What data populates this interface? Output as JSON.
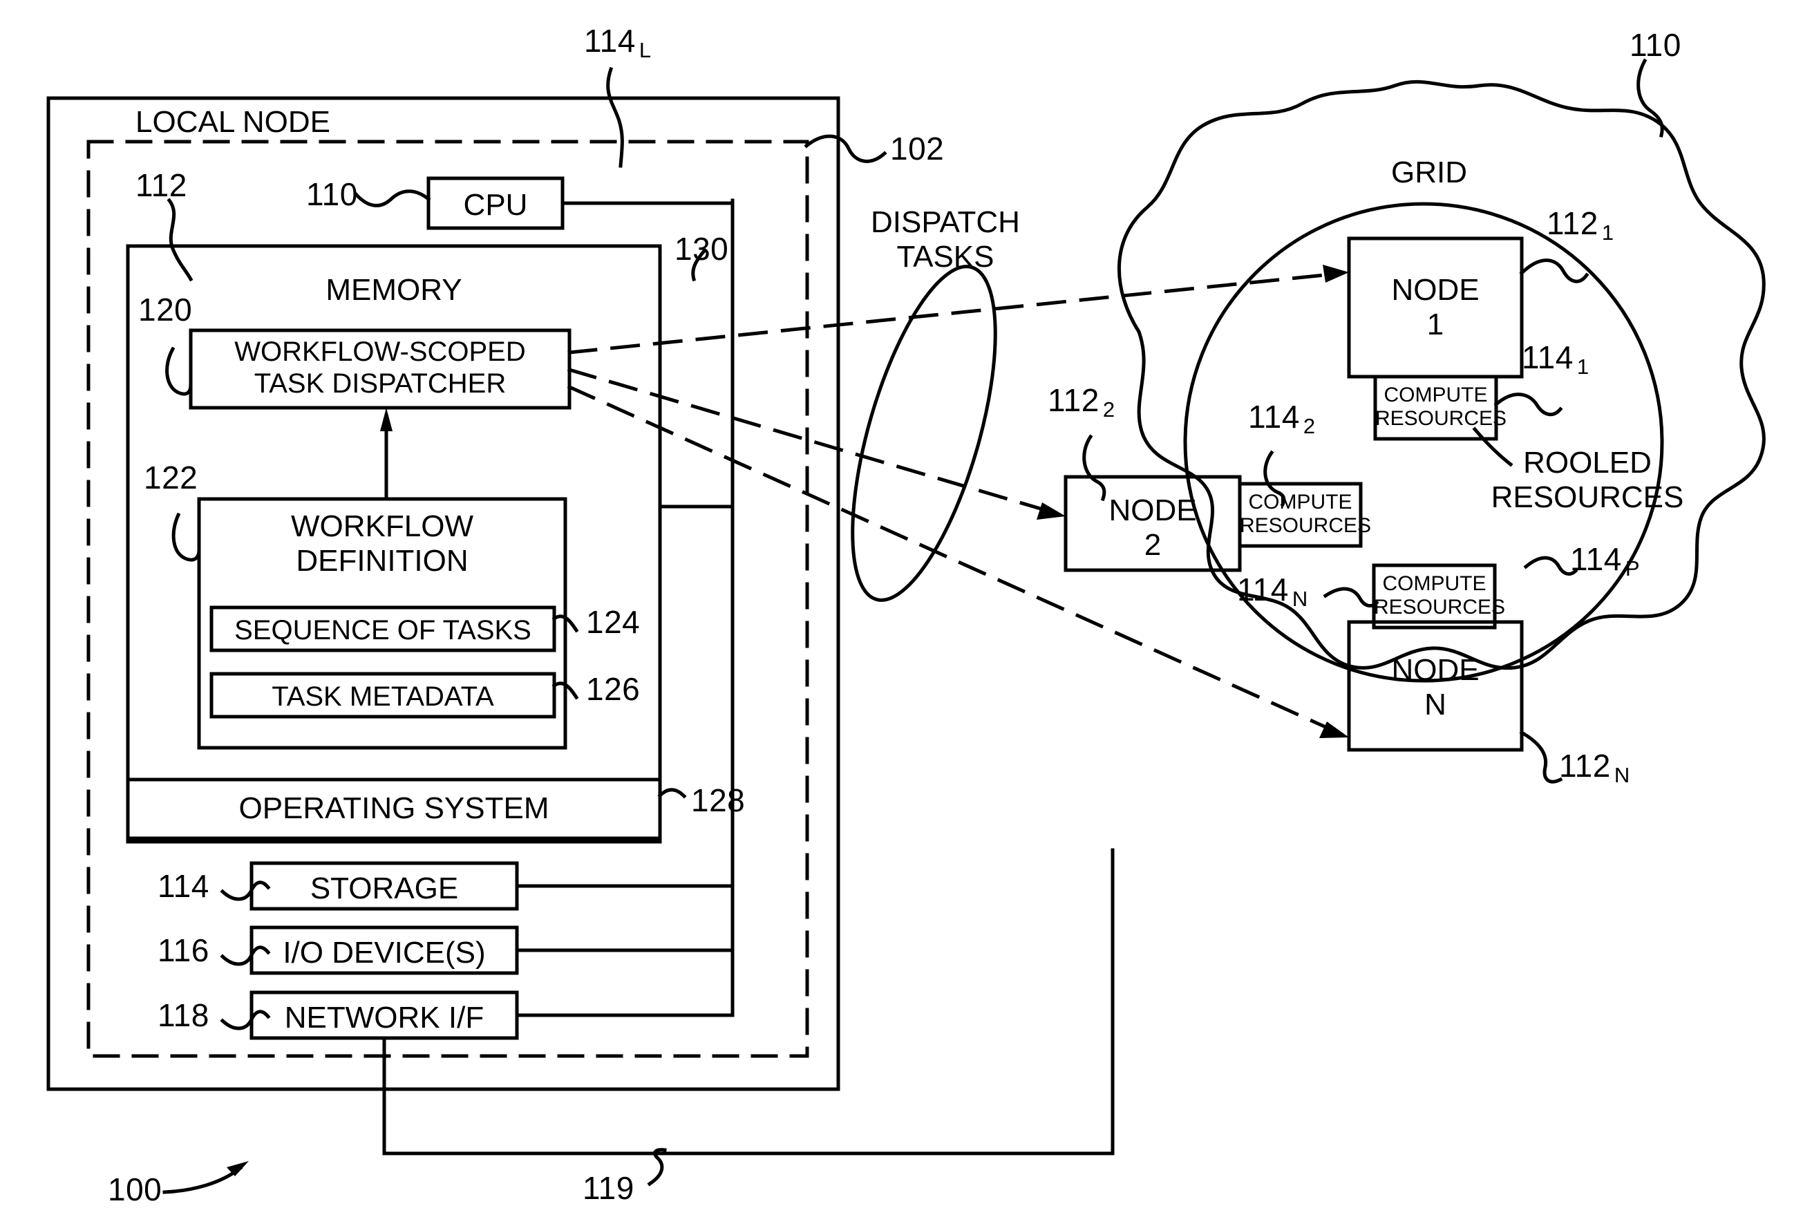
{
  "figure": {
    "number": "100",
    "local_node": {
      "title": "LOCAL NODE",
      "outer_ref": "114",
      "outer_ref_sub": "L",
      "dashed_ref": "102",
      "cpu": {
        "label": "CPU",
        "ref": "110"
      },
      "memory": {
        "label": "MEMORY",
        "ref": "112"
      },
      "bus_ref": "130",
      "dispatcher": {
        "label_line1": "WORKFLOW-SCOPED",
        "label_line2": "TASK DISPATCHER",
        "ref": "120"
      },
      "workflow_definition": {
        "label_line1": "WORKFLOW",
        "label_line2": "DEFINITION",
        "ref": "122",
        "children": [
          {
            "label": "SEQUENCE OF TASKS",
            "ref": "124"
          },
          {
            "label": "TASK METADATA",
            "ref": "126"
          }
        ]
      },
      "operating_system": {
        "label": "OPERATING SYSTEM",
        "ref": "128"
      },
      "devices": [
        {
          "label": "STORAGE",
          "ref": "114"
        },
        {
          "label": "I/O DEVICE(S)",
          "ref": "116"
        },
        {
          "label": "NETWORK I/F",
          "ref": "118"
        }
      ],
      "network_ref": "119"
    },
    "dispatch": {
      "label_line1": "DISPATCH",
      "label_line2": "TASKS"
    },
    "grid": {
      "title": "GRID",
      "ref": "110",
      "pooled_label_line1": "ROOLED",
      "pooled_label_line2": "RESOURCES",
      "pooled_ref": "114",
      "pooled_ref_sub": "P",
      "nodes": [
        {
          "label_line1": "NODE",
          "label_line2": "1",
          "ref": "112",
          "ref_sub": "1",
          "compute": {
            "line1": "COMPUTE",
            "line2": "RESOURCES",
            "ref": "114",
            "ref_sub": "1"
          }
        },
        {
          "label_line1": "NODE",
          "label_line2": "2",
          "ref": "112",
          "ref_sub": "2",
          "compute": {
            "line1": "COMPUTE",
            "line2": "RESOURCES",
            "ref": "114",
            "ref_sub": "2"
          }
        },
        {
          "label_line1": "NODE",
          "label_line2": "N",
          "ref": "112",
          "ref_sub": "N",
          "compute": {
            "line1": "COMPUTE",
            "line2": "RESOURCES",
            "ref": "114",
            "ref_sub": "N"
          }
        }
      ]
    }
  }
}
